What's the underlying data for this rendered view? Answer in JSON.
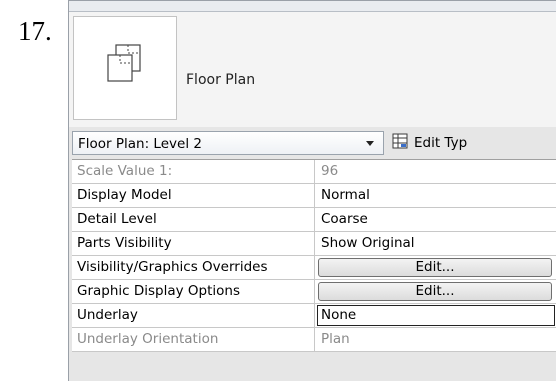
{
  "step_number": "17.",
  "type_selector": {
    "type_name": "Floor Plan",
    "thumbnail_icon": "floor-plan-views-icon"
  },
  "instance_dropdown": {
    "value": "Floor Plan: Level 2"
  },
  "edit_type": {
    "label": "Edit Typ",
    "icon": "edit-type-icon"
  },
  "properties": [
    {
      "name": "Scale Value    1:",
      "value": "96",
      "disabled": true
    },
    {
      "name": "Display Model",
      "value": "Normal"
    },
    {
      "name": "Detail Level",
      "value": "Coarse"
    },
    {
      "name": "Parts Visibility",
      "value": "Show Original"
    },
    {
      "name": "Visibility/Graphics Overrides",
      "value": "Edit...",
      "is_button": true
    },
    {
      "name": "Graphic Display Options",
      "value": "Edit...",
      "is_button": true
    },
    {
      "name": "Underlay",
      "value": "None",
      "selected": true
    },
    {
      "name": "Underlay Orientation",
      "value": "Plan",
      "disabled": true
    }
  ]
}
